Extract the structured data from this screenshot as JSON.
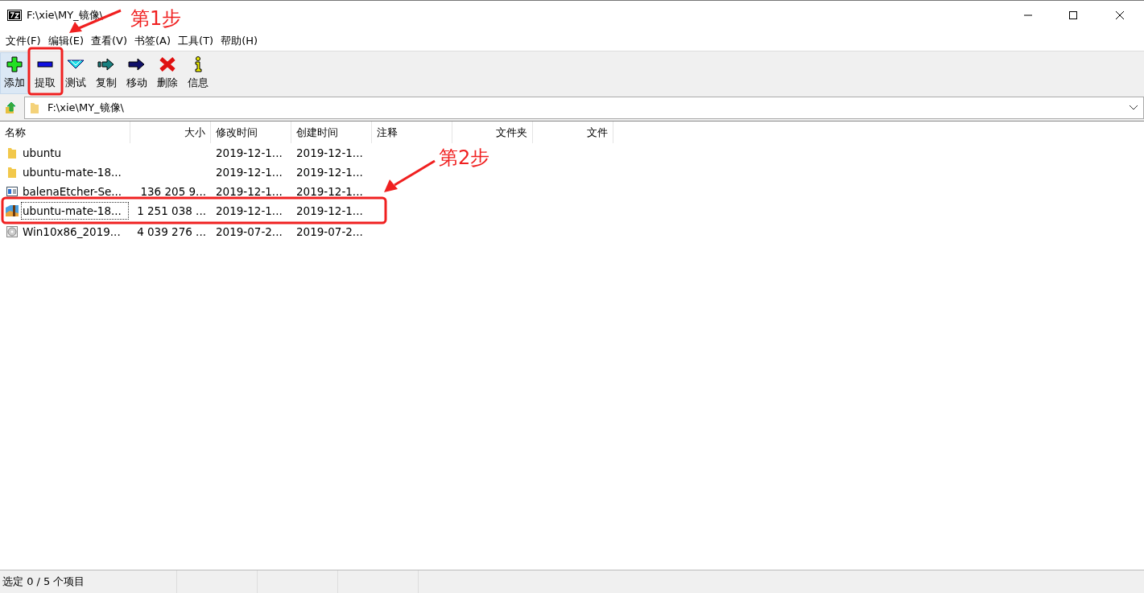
{
  "window": {
    "title": "F:\\xie\\MY_镜像\\"
  },
  "menu": [
    "文件(F)",
    "编辑(E)",
    "查看(V)",
    "书签(A)",
    "工具(T)",
    "帮助(H)"
  ],
  "toolbar": [
    {
      "kind": "add",
      "label": "添加",
      "highlighted": true
    },
    {
      "kind": "extract",
      "label": "提取",
      "highlighted": false
    },
    {
      "kind": "test",
      "label": "测试",
      "highlighted": false
    },
    {
      "kind": "copy",
      "label": "复制",
      "highlighted": false
    },
    {
      "kind": "move",
      "label": "移动",
      "highlighted": false
    },
    {
      "kind": "delete",
      "label": "删除",
      "highlighted": false
    },
    {
      "kind": "info",
      "label": "信息",
      "highlighted": false
    }
  ],
  "address": {
    "value": "F:\\xie\\MY_镜像\\"
  },
  "table": {
    "columns": [
      "名称",
      "大小",
      "修改时间",
      "创建时间",
      "注释",
      "文件夹",
      "文件"
    ],
    "rows": [
      {
        "kind": "folder",
        "focused": false,
        "cells": [
          "ubuntu",
          "",
          "2019-12-1...",
          "2019-12-1..."
        ]
      },
      {
        "kind": "folder",
        "focused": false,
        "cells": [
          "ubuntu-mate-18...",
          "",
          "2019-12-1...",
          "2019-12-1..."
        ]
      },
      {
        "kind": "app",
        "focused": false,
        "cells": [
          "balenaEtcher-Se...",
          "136 205 9...",
          "2019-12-1...",
          "2019-12-1..."
        ]
      },
      {
        "kind": "archive",
        "focused": true,
        "cells": [
          "ubuntu-mate-18...",
          "1 251 038 ...",
          "2019-12-1...",
          "2019-12-1..."
        ]
      },
      {
        "kind": "disc",
        "focused": false,
        "cells": [
          "Win10x86_2019...",
          "4 039 276 ...",
          "2019-07-2...",
          "2019-07-2..."
        ]
      }
    ]
  },
  "status_bar": {
    "text": "选定 0 / 5 个项目"
  },
  "annotations": [
    {
      "label": "第1步"
    },
    {
      "label": "第2步"
    }
  ]
}
